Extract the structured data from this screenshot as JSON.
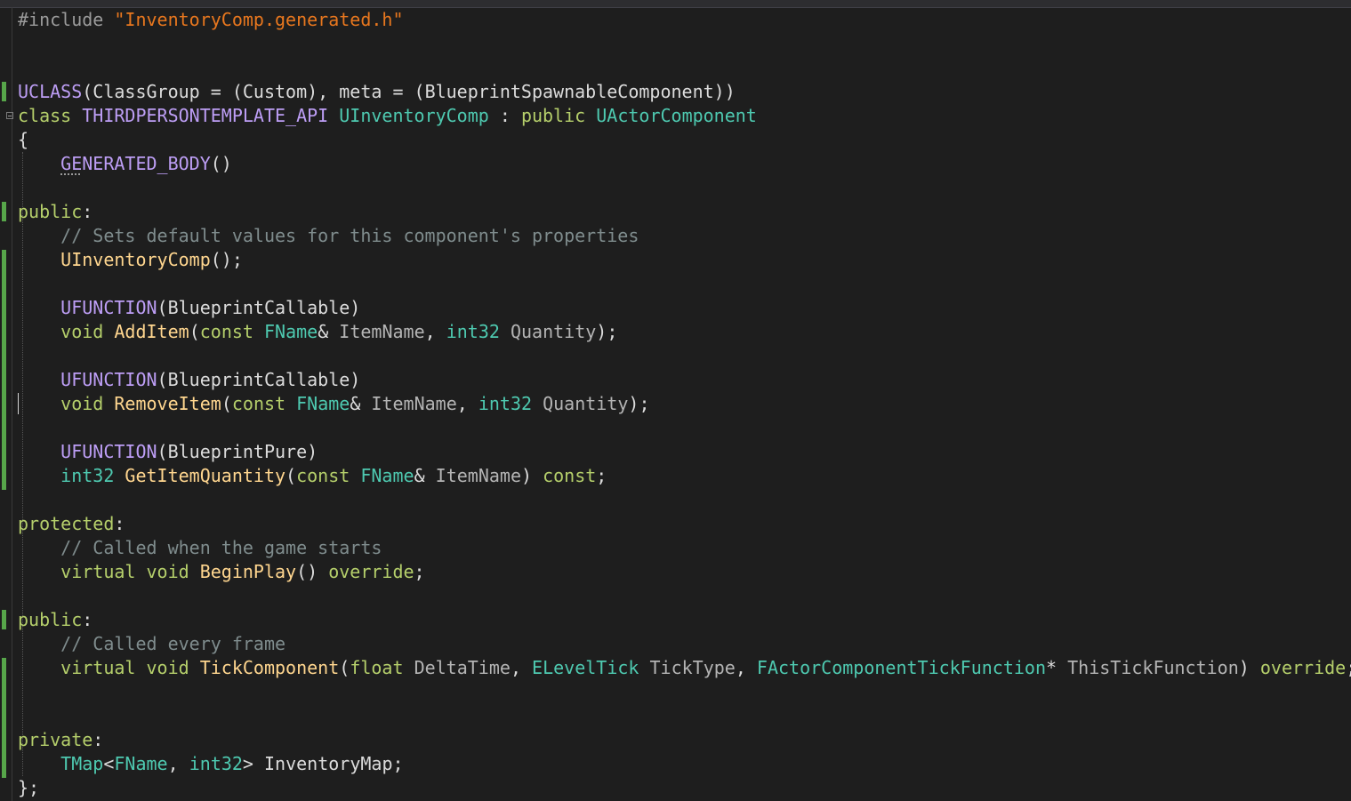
{
  "editor": {
    "file": "InventoryComp.h",
    "lines": [
      [
        {
          "t": "#include ",
          "c": "t-pre"
        },
        {
          "t": "\"InventoryComp.generated.h\"",
          "c": "t-str"
        }
      ],
      [],
      [],
      [
        {
          "t": "UCLASS",
          "c": "t-mac"
        },
        {
          "t": "(ClassGroup = (Custom), meta = (BlueprintSpawnableComponent))",
          "c": "t-plain"
        }
      ],
      [
        {
          "t": "class ",
          "c": "t-kw"
        },
        {
          "t": "THIRDPERSONTEMPLATE_API ",
          "c": "t-mac"
        },
        {
          "t": "UInventoryComp",
          "c": "t-type"
        },
        {
          "t": " : ",
          "c": "t-plain"
        },
        {
          "t": "public ",
          "c": "t-kw"
        },
        {
          "t": "UActorComponent",
          "c": "t-type"
        }
      ],
      [
        {
          "t": "{",
          "c": "t-plain"
        }
      ],
      [
        {
          "t": "    ",
          "c": "t-plain"
        },
        {
          "t": "GENERATED_BODY",
          "c": "t-mac"
        },
        {
          "t": "()",
          "c": "t-plain"
        }
      ],
      [],
      [
        {
          "t": "public",
          "c": "t-kw"
        },
        {
          "t": ":",
          "c": "t-plain"
        }
      ],
      [
        {
          "t": "    // Sets default values for this component's properties",
          "c": "t-com"
        }
      ],
      [
        {
          "t": "    ",
          "c": "t-plain"
        },
        {
          "t": "UInventoryComp",
          "c": "t-fn"
        },
        {
          "t": "();",
          "c": "t-plain"
        }
      ],
      [],
      [
        {
          "t": "    ",
          "c": "t-plain"
        },
        {
          "t": "UFUNCTION",
          "c": "t-mac"
        },
        {
          "t": "(BlueprintCallable)",
          "c": "t-plain"
        }
      ],
      [
        {
          "t": "    ",
          "c": "t-plain"
        },
        {
          "t": "void ",
          "c": "t-kw"
        },
        {
          "t": "AddItem",
          "c": "t-fn"
        },
        {
          "t": "(",
          "c": "t-plain"
        },
        {
          "t": "const ",
          "c": "t-kw"
        },
        {
          "t": "FName",
          "c": "t-type"
        },
        {
          "t": "& ",
          "c": "t-plain"
        },
        {
          "t": "ItemName",
          "c": "t-param"
        },
        {
          "t": ", ",
          "c": "t-plain"
        },
        {
          "t": "int32 ",
          "c": "t-type"
        },
        {
          "t": "Quantity",
          "c": "t-param"
        },
        {
          "t": ");",
          "c": "t-plain"
        }
      ],
      [],
      [
        {
          "t": "    ",
          "c": "t-plain"
        },
        {
          "t": "UFUNCTION",
          "c": "t-mac"
        },
        {
          "t": "(BlueprintCallable)",
          "c": "t-plain"
        }
      ],
      [
        {
          "t": "    ",
          "c": "t-plain"
        },
        {
          "t": "void ",
          "c": "t-kw"
        },
        {
          "t": "RemoveItem",
          "c": "t-fn"
        },
        {
          "t": "(",
          "c": "t-plain"
        },
        {
          "t": "const ",
          "c": "t-kw"
        },
        {
          "t": "FName",
          "c": "t-type"
        },
        {
          "t": "& ",
          "c": "t-plain"
        },
        {
          "t": "ItemName",
          "c": "t-param"
        },
        {
          "t": ", ",
          "c": "t-plain"
        },
        {
          "t": "int32 ",
          "c": "t-type"
        },
        {
          "t": "Quantity",
          "c": "t-param"
        },
        {
          "t": ");",
          "c": "t-plain"
        }
      ],
      [],
      [
        {
          "t": "    ",
          "c": "t-plain"
        },
        {
          "t": "UFUNCTION",
          "c": "t-mac"
        },
        {
          "t": "(BlueprintPure)",
          "c": "t-plain"
        }
      ],
      [
        {
          "t": "    ",
          "c": "t-plain"
        },
        {
          "t": "int32 ",
          "c": "t-type"
        },
        {
          "t": "GetItemQuantity",
          "c": "t-fn"
        },
        {
          "t": "(",
          "c": "t-plain"
        },
        {
          "t": "const ",
          "c": "t-kw"
        },
        {
          "t": "FName",
          "c": "t-type"
        },
        {
          "t": "& ",
          "c": "t-plain"
        },
        {
          "t": "ItemName",
          "c": "t-param"
        },
        {
          "t": ") ",
          "c": "t-plain"
        },
        {
          "t": "const",
          "c": "t-kw"
        },
        {
          "t": ";",
          "c": "t-plain"
        }
      ],
      [],
      [
        {
          "t": "protected",
          "c": "t-kw"
        },
        {
          "t": ":",
          "c": "t-plain"
        }
      ],
      [
        {
          "t": "    // Called when the game starts",
          "c": "t-com"
        }
      ],
      [
        {
          "t": "    ",
          "c": "t-plain"
        },
        {
          "t": "virtual ",
          "c": "t-kw"
        },
        {
          "t": "void ",
          "c": "t-kw"
        },
        {
          "t": "BeginPlay",
          "c": "t-fn"
        },
        {
          "t": "() ",
          "c": "t-plain"
        },
        {
          "t": "override",
          "c": "t-kw"
        },
        {
          "t": ";",
          "c": "t-plain"
        }
      ],
      [],
      [
        {
          "t": "public",
          "c": "t-kw"
        },
        {
          "t": ":",
          "c": "t-plain"
        }
      ],
      [
        {
          "t": "    // Called every frame",
          "c": "t-com"
        }
      ],
      [
        {
          "t": "    ",
          "c": "t-plain"
        },
        {
          "t": "virtual ",
          "c": "t-kw"
        },
        {
          "t": "void ",
          "c": "t-kw"
        },
        {
          "t": "TickComponent",
          "c": "t-fn"
        },
        {
          "t": "(",
          "c": "t-plain"
        },
        {
          "t": "float ",
          "c": "t-kw"
        },
        {
          "t": "DeltaTime",
          "c": "t-param"
        },
        {
          "t": ", ",
          "c": "t-plain"
        },
        {
          "t": "ELevelTick ",
          "c": "t-type"
        },
        {
          "t": "TickType",
          "c": "t-param"
        },
        {
          "t": ", ",
          "c": "t-plain"
        },
        {
          "t": "FActorComponentTickFunction",
          "c": "t-type"
        },
        {
          "t": "* ",
          "c": "t-plain"
        },
        {
          "t": "ThisTickFunction",
          "c": "t-param"
        },
        {
          "t": ") ",
          "c": "t-plain"
        },
        {
          "t": "override",
          "c": "t-kw"
        },
        {
          "t": ";",
          "c": "t-plain"
        }
      ],
      [],
      [],
      [
        {
          "t": "private",
          "c": "t-kw"
        },
        {
          "t": ":",
          "c": "t-plain"
        }
      ],
      [
        {
          "t": "    ",
          "c": "t-plain"
        },
        {
          "t": "TMap",
          "c": "t-type"
        },
        {
          "t": "<",
          "c": "t-plain"
        },
        {
          "t": "FName",
          "c": "t-type"
        },
        {
          "t": ", ",
          "c": "t-plain"
        },
        {
          "t": "int32",
          "c": "t-type"
        },
        {
          "t": "> ",
          "c": "t-plain"
        },
        {
          "t": "InventoryMap",
          "c": "t-plain"
        },
        {
          "t": ";",
          "c": "t-plain"
        }
      ],
      [
        {
          "t": "};",
          "c": "t-plain"
        }
      ]
    ]
  },
  "colors": {
    "background": "#1e1e1e",
    "change_bar": "#57a64a",
    "keyword": "#b5cf6b",
    "type": "#4ec9b0",
    "macro": "#bd9ef5",
    "string": "#e8771e",
    "comment": "#7f8c8d",
    "function": "#ffd68f"
  }
}
